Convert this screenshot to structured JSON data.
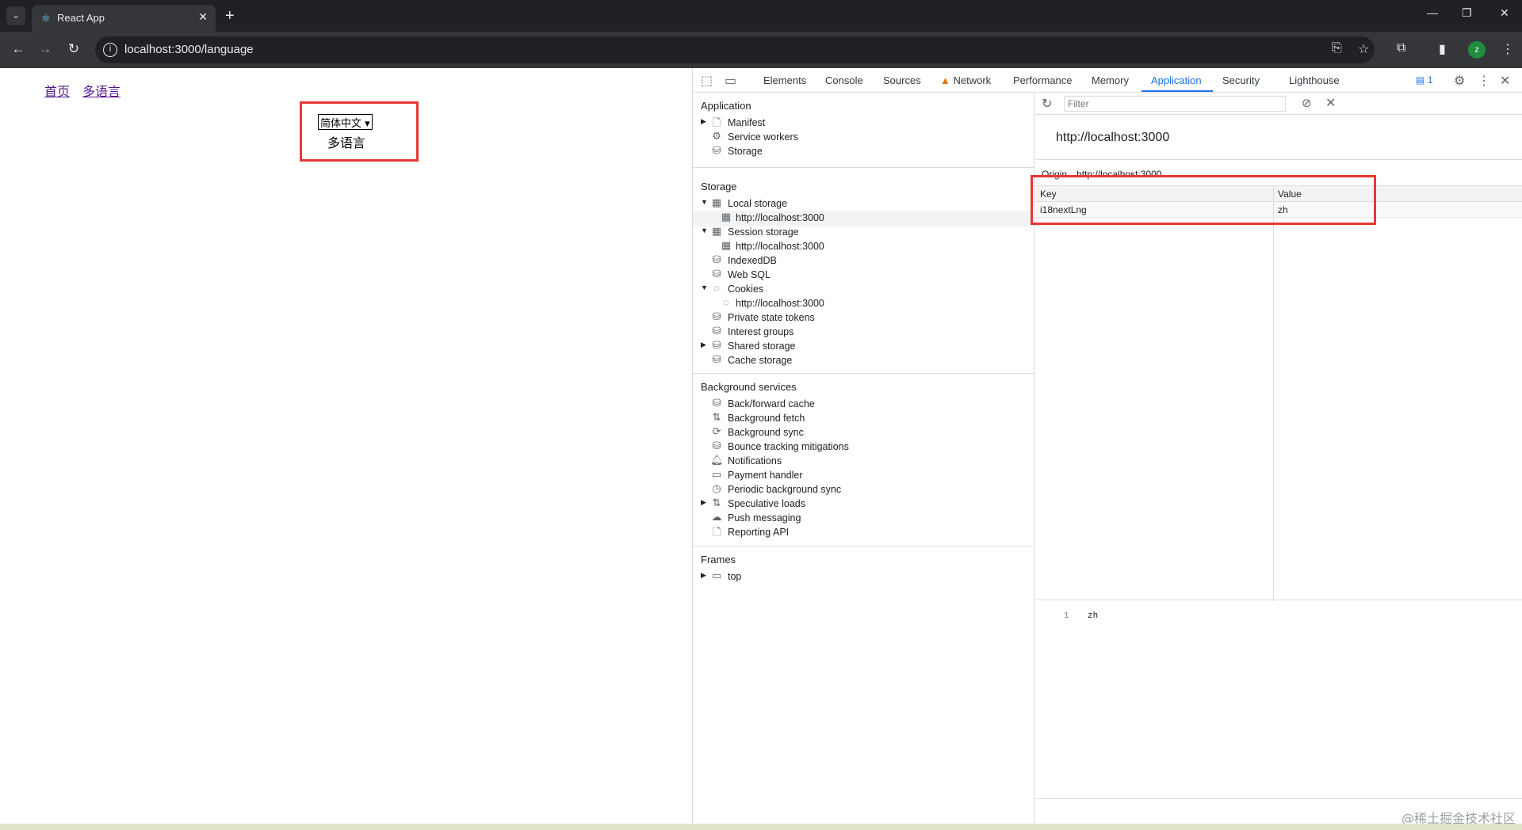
{
  "browser": {
    "tab_title": "React App",
    "url": "localhost:3000/language"
  },
  "page": {
    "nav": [
      "首页",
      "多语言"
    ],
    "language_select": "简体中文",
    "language_text": "多语言"
  },
  "devtools": {
    "tabs": [
      "Elements",
      "Console",
      "Sources",
      "Network",
      "Performance",
      "Memory",
      "Application",
      "Security",
      "Lighthouse"
    ],
    "active_tab": "Application",
    "message_count": "1",
    "sidebar": {
      "application_title": "Application",
      "application_items": [
        "Manifest",
        "Service workers",
        "Storage"
      ],
      "storage_title": "Storage",
      "local_storage": "Local storage",
      "local_storage_origin": "http://localhost:3000",
      "session_storage": "Session storage",
      "session_storage_origin": "http://localhost:3000",
      "indexeddb": "IndexedDB",
      "websql": "Web SQL",
      "cookies": "Cookies",
      "cookies_origin": "http://localhost:3000",
      "private_state_tokens": "Private state tokens",
      "interest_groups": "Interest groups",
      "shared_storage": "Shared storage",
      "cache_storage": "Cache storage",
      "background_title": "Background services",
      "background_items": [
        "Back/forward cache",
        "Background fetch",
        "Background sync",
        "Bounce tracking mitigations",
        "Notifications",
        "Payment handler",
        "Periodic background sync",
        "Speculative loads",
        "Push messaging",
        "Reporting API"
      ],
      "frames_title": "Frames",
      "frames_top": "top"
    },
    "panel": {
      "filter_placeholder": "Filter",
      "origin_title": "http://localhost:3000",
      "origin_label": "Origin",
      "origin_value": "http://localhost:3000",
      "columns": [
        "Key",
        "Value"
      ],
      "rows": [
        {
          "key": "i18nextLng",
          "value": "zh"
        }
      ],
      "preview_line": "1",
      "preview_value": "zh"
    }
  },
  "watermark": "@稀土掘金技术社区"
}
